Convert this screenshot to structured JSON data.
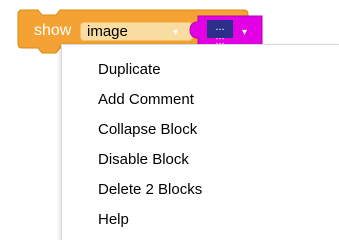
{
  "block": {
    "label": "show",
    "dropdown_value": "image",
    "dropdown_arrow": "▾",
    "image_icon": "...\n:::",
    "image_arrow": "▾",
    "colors": {
      "block_orange": "#f3a233",
      "block_border": "#d98a12",
      "image_block_magenta": "#e400e4",
      "field_bg": "#f8dca0"
    }
  },
  "context_menu": {
    "items": [
      {
        "label": "Duplicate"
      },
      {
        "label": "Add Comment"
      },
      {
        "label": "Collapse Block"
      },
      {
        "label": "Disable Block"
      },
      {
        "label": "Delete 2 Blocks"
      },
      {
        "label": "Help"
      }
    ]
  }
}
